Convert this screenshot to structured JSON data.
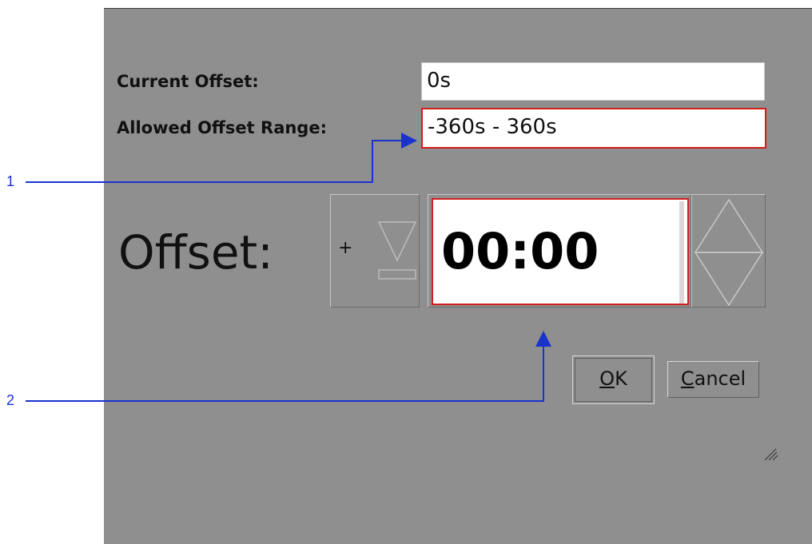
{
  "dialog": {
    "current_offset_label": "Current Offset:",
    "current_offset_value": "0s",
    "allowed_range_label": "Allowed Offset Range:",
    "allowed_range_value": "-360s - 360s",
    "offset_label": "Offset:",
    "sign": "+",
    "time_value": "00:00",
    "ok_label": "OK",
    "ok_mnemonic": "O",
    "ok_rest": "K",
    "cancel_label": "Cancel",
    "cancel_mnemonic": "C",
    "cancel_rest": "ancel"
  },
  "callouts": [
    {
      "number": "1"
    },
    {
      "number": "2"
    }
  ],
  "colors": {
    "dialog_bg": "#8f8f8f",
    "highlight_border": "#d21e1e",
    "callout_line": "#1a33cc"
  },
  "icons": [
    "sign-toggle-down-triangle-icon",
    "spin-up-arrow-icon",
    "spin-down-arrow-icon",
    "resize-grip-icon"
  ]
}
